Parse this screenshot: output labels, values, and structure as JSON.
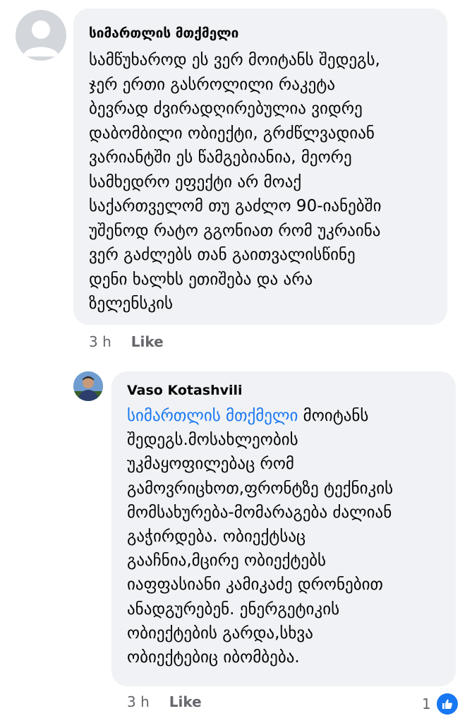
{
  "comments": [
    {
      "author": "სიმართლის მთქმელი",
      "text": "სამწუხაროდ ეს ვერ მოიტანს შედეგს,\nჯერ ერთი გასროლილი რაკეტა\nბევრად ძვირადღირებულია ვიდრე\nდაბომბილი ობიექტი, გრძწლვადიან\nვარიანტში ეს წამგებიანია, მეორე\nსამხედრო ეფექტი არ მოაქ\nსაქართველომ თუ გაძლო 90-იანებში\nუშენოდ რატო გგონიათ რომ უკრაინა\nვერ გაძლებს თან გაითვალისწინე\nდენი ხალხს ეთიშება და არა\nზელენსკის",
      "time": "3 h",
      "like_label": "Like",
      "avatar": "default-profile-icon"
    },
    {
      "author": "Vaso Kotashvili",
      "mention": "სიმართლის მთქმელი",
      "text": " მოიტანს\nშედეგს.მოსახლეობის\nუკმაყოფილებაც რომ\nგამოვრიცხოთ,ფრონტზე ტექნიკის\nმომსახურება-მომარაგება ძალიან\nგაჭირდება. ობიექტსაც\nგააჩნია,მცირე ობიექტებს\nიაფფასიანი კამიკაძე დრონებით\nანადგურებენ.  ენერგეტიკის\nობიექტების გარდა,სხვა\nობიექტებიც იბომბება.",
      "time": "3 h",
      "like_label": "Like",
      "reaction_count": "1",
      "reaction_icon": "thumbs-up-icon",
      "avatar": "user-photo"
    }
  ],
  "colors": {
    "bubble": "#f0f2f5",
    "mention": "#1877f2",
    "meta": "#65676b",
    "like_badge": "#1877f2"
  }
}
